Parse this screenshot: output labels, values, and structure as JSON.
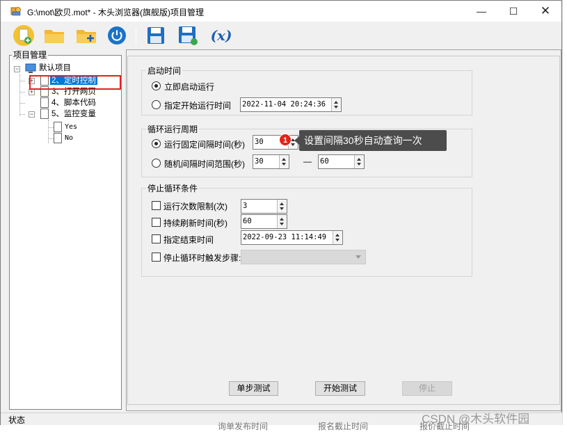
{
  "window": {
    "title": "G:\\mot\\欧贝.mot* - 木头浏览器(旗舰版)项目管理",
    "minimize_glyph": "—",
    "maximize_glyph": "☐",
    "close_glyph": "✕"
  },
  "toolbar": {
    "icons": [
      "new-project-icon",
      "open-folder-icon",
      "add-folder-icon",
      "power-icon",
      "save-icon",
      "save-as-icon",
      "variable-icon"
    ],
    "variable_label": "(𝒙)"
  },
  "tree": {
    "panel_title": "项目管理",
    "root": "默认项目",
    "items": [
      "2、定时控制",
      "3、打开网页",
      "4、脚本代码",
      "5、监控变量"
    ],
    "monitor_children": [
      "Yes",
      "No"
    ],
    "selected_index": 0
  },
  "start": {
    "group_title": "启动时间",
    "immediate_label": "立即启动运行",
    "scheduled_label": "指定开始运行时间",
    "scheduled_value": "2022-11-04 20:24:36",
    "selected": "immediate"
  },
  "cycle": {
    "group_title": "循环运行周期",
    "fixed_label": "运行固定间隔时间(秒)",
    "fixed_value": "30",
    "random_label": "随机间隔时间范围(秒)",
    "random_min": "30",
    "random_dash": "—",
    "random_max": "60",
    "selected": "fixed"
  },
  "stop": {
    "group_title": "停止循环条件",
    "count_label": "运行次数限制(次)",
    "count_value": "3",
    "refresh_label": "持续刷新时间(秒)",
    "refresh_value": "60",
    "end_label": "指定结束时间",
    "end_value": "2022-09-23 11:14:49",
    "trigger_label": "停止循环时触发步骤:"
  },
  "annotation": {
    "badge": "1",
    "tooltip": "设置间隔30秒自动查询一次"
  },
  "buttons": {
    "step_test": "单步测试",
    "start_test": "开始测试",
    "stop": "停止"
  },
  "status": {
    "label": "状态"
  },
  "background": {
    "left_text": "询单发布时间",
    "mid_text": "报名截止时间",
    "right_text": "报价截止时间"
  },
  "watermark": "CSDN @木头软件园"
}
